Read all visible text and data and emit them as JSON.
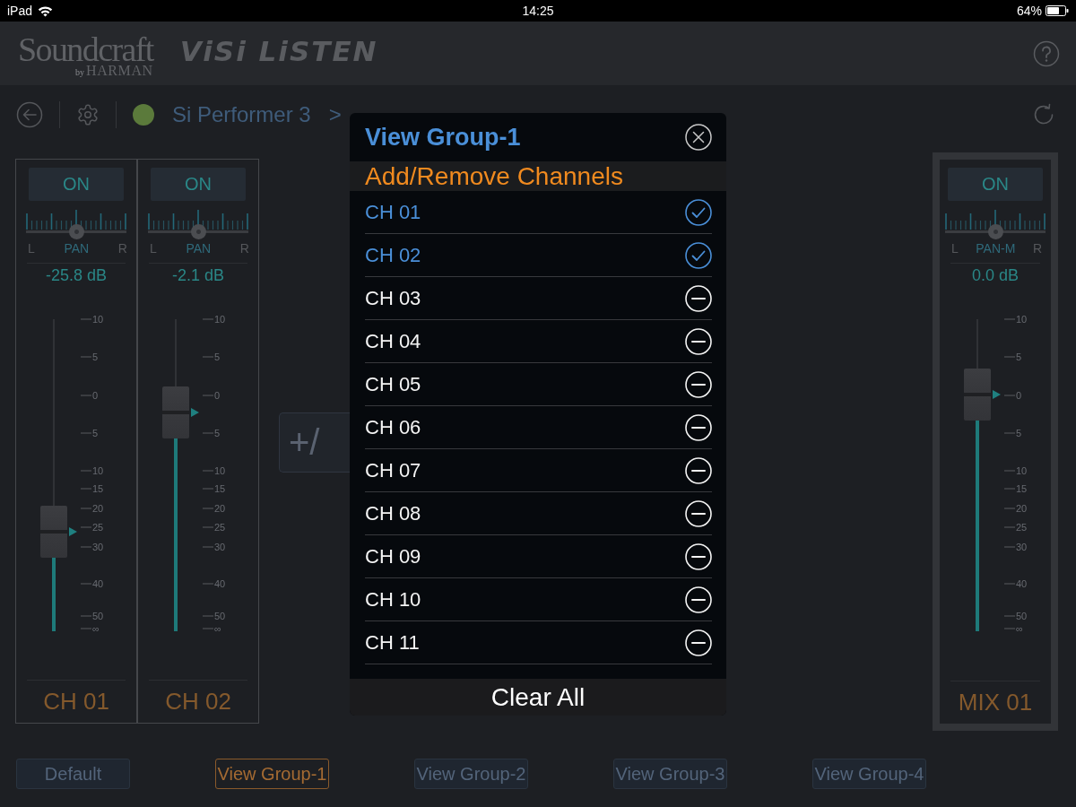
{
  "status_bar": {
    "device": "iPad",
    "time": "14:25",
    "battery": "64%"
  },
  "header": {
    "brand": "Soundcraft",
    "byline": "by",
    "company": "HARMAN",
    "product": "ViSi LiSTEN"
  },
  "toolbar": {
    "connected": true,
    "device": "Si Performer 3",
    "separator": ">"
  },
  "strips": [
    {
      "name": "CH 01",
      "selected": false,
      "on": true,
      "on_label": "ON",
      "pan": {
        "left": "L",
        "label": "PAN",
        "right": "R",
        "level": 0.5
      },
      "reading": "-25.8 dB",
      "fader": {
        "level": 0.32
      },
      "scale": [
        "10",
        "5",
        "0",
        "5",
        "10",
        "15",
        "20",
        "25",
        "30",
        "40",
        "50",
        "∞"
      ]
    },
    {
      "name": "CH 02",
      "selected": false,
      "on": true,
      "on_label": "ON",
      "pan": {
        "left": "L",
        "label": "PAN",
        "right": "R",
        "level": 0.5
      },
      "reading": "-2.1 dB",
      "fader": {
        "level": 0.7
      },
      "scale": [
        "10",
        "5",
        "0",
        "5",
        "10",
        "15",
        "20",
        "25",
        "30",
        "40",
        "50",
        "∞"
      ]
    }
  ],
  "group_button": {
    "label": "+/"
  },
  "mix_strip": {
    "name": "MIX 01",
    "selected": true,
    "on": true,
    "on_label": "ON",
    "pan": {
      "left": "L",
      "label": "PAN-M",
      "right": "R",
      "level": 0.5
    },
    "reading": "0.0 dB",
    "fader": {
      "level": 0.76
    },
    "scale": [
      "10",
      "5",
      "0",
      "5",
      "10",
      "15",
      "20",
      "25",
      "30",
      "40",
      "50",
      "∞"
    ]
  },
  "dialog": {
    "title": "View Group-1",
    "subtitle": "Add/Remove Channels",
    "channels": [
      {
        "label": "CH 01",
        "checked": true
      },
      {
        "label": "CH 02",
        "checked": true
      },
      {
        "label": "CH 03",
        "checked": false
      },
      {
        "label": "CH 04",
        "checked": false
      },
      {
        "label": "CH 05",
        "checked": false
      },
      {
        "label": "CH 06",
        "checked": false
      },
      {
        "label": "CH 07",
        "checked": false
      },
      {
        "label": "CH 08",
        "checked": false
      },
      {
        "label": "CH 09",
        "checked": false
      },
      {
        "label": "CH 10",
        "checked": false
      },
      {
        "label": "CH 11",
        "checked": false
      }
    ],
    "clear_button": "Clear All"
  },
  "view_tabs": [
    {
      "label": "Default",
      "selected": false
    },
    {
      "label": "View Group-1",
      "selected": true
    },
    {
      "label": "View Group-2",
      "selected": false
    },
    {
      "label": "View Group-3",
      "selected": false
    },
    {
      "label": "View Group-4",
      "selected": false
    }
  ]
}
